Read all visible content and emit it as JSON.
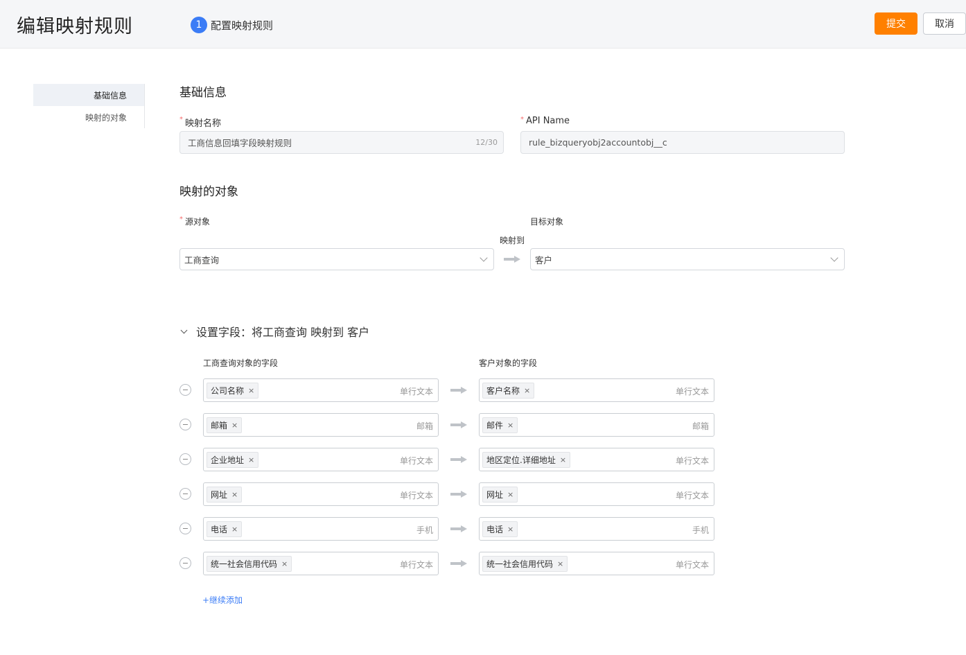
{
  "header": {
    "title": "编辑映射规则",
    "step_number": "1",
    "step_label": "配置映射规则",
    "submit_label": "提交",
    "cancel_label": "取消"
  },
  "sidebar": {
    "items": [
      {
        "label": "基础信息",
        "active": true
      },
      {
        "label": "映射的对象",
        "active": false
      }
    ]
  },
  "basic_info": {
    "section_title": "基础信息",
    "name_label": "映射名称",
    "name_value": "工商信息回填字段映射规则",
    "name_counter": "12/30",
    "api_label": "API Name",
    "api_value": "rule_bizqueryobj2accountobj__c"
  },
  "mapping_object": {
    "section_title": "映射的对象",
    "source_label": "源对象",
    "source_value": "工商查询",
    "mapped_to_label": "映射到",
    "target_label": "目标对象",
    "target_value": "客户"
  },
  "fields": {
    "section_title": "设置字段：将工商查询 映射到 客户",
    "source_header": "工商查询对象的字段",
    "target_header": "客户对象的字段",
    "rows": [
      {
        "source": "公司名称",
        "source_type": "单行文本",
        "target": "客户名称",
        "target_type": "单行文本"
      },
      {
        "source": "邮箱",
        "source_type": "邮箱",
        "target": "邮件",
        "target_type": "邮箱"
      },
      {
        "source": "企业地址",
        "source_type": "单行文本",
        "target": "地区定位.详细地址",
        "target_type": "单行文本"
      },
      {
        "source": "网址",
        "source_type": "单行文本",
        "target": "网址",
        "target_type": "单行文本"
      },
      {
        "source": "电话",
        "source_type": "手机",
        "target": "电话",
        "target_type": "手机"
      },
      {
        "source": "统一社会信用代码",
        "source_type": "单行文本",
        "target": "统一社会信用代码",
        "target_type": "单行文本"
      }
    ],
    "tag_remove_symbol": "×",
    "add_more_label": "+继续添加"
  },
  "colors": {
    "accent": "#ff8000",
    "primary": "#3b7cf6",
    "required": "#f56c6c"
  }
}
